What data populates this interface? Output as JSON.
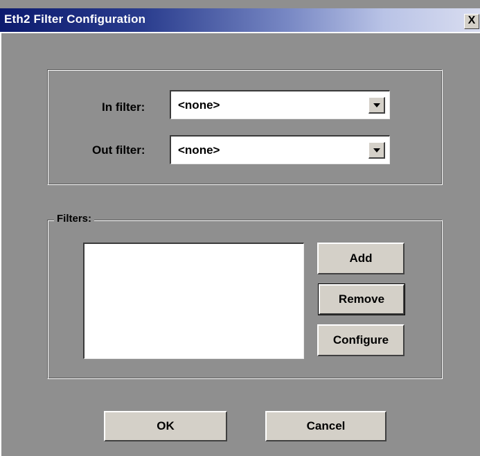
{
  "window": {
    "title": "Eth2 Filter Configuration",
    "close_label": "X"
  },
  "filters_top": {
    "in_label": "In filter:",
    "in_value": "<none>",
    "out_label": "Out filter:",
    "out_value": "<none>"
  },
  "filters_group": {
    "label": "Filters:",
    "items": [],
    "add_label": "Add",
    "remove_label": "Remove",
    "configure_label": "Configure"
  },
  "footer": {
    "ok_label": "OK",
    "cancel_label": "Cancel"
  }
}
